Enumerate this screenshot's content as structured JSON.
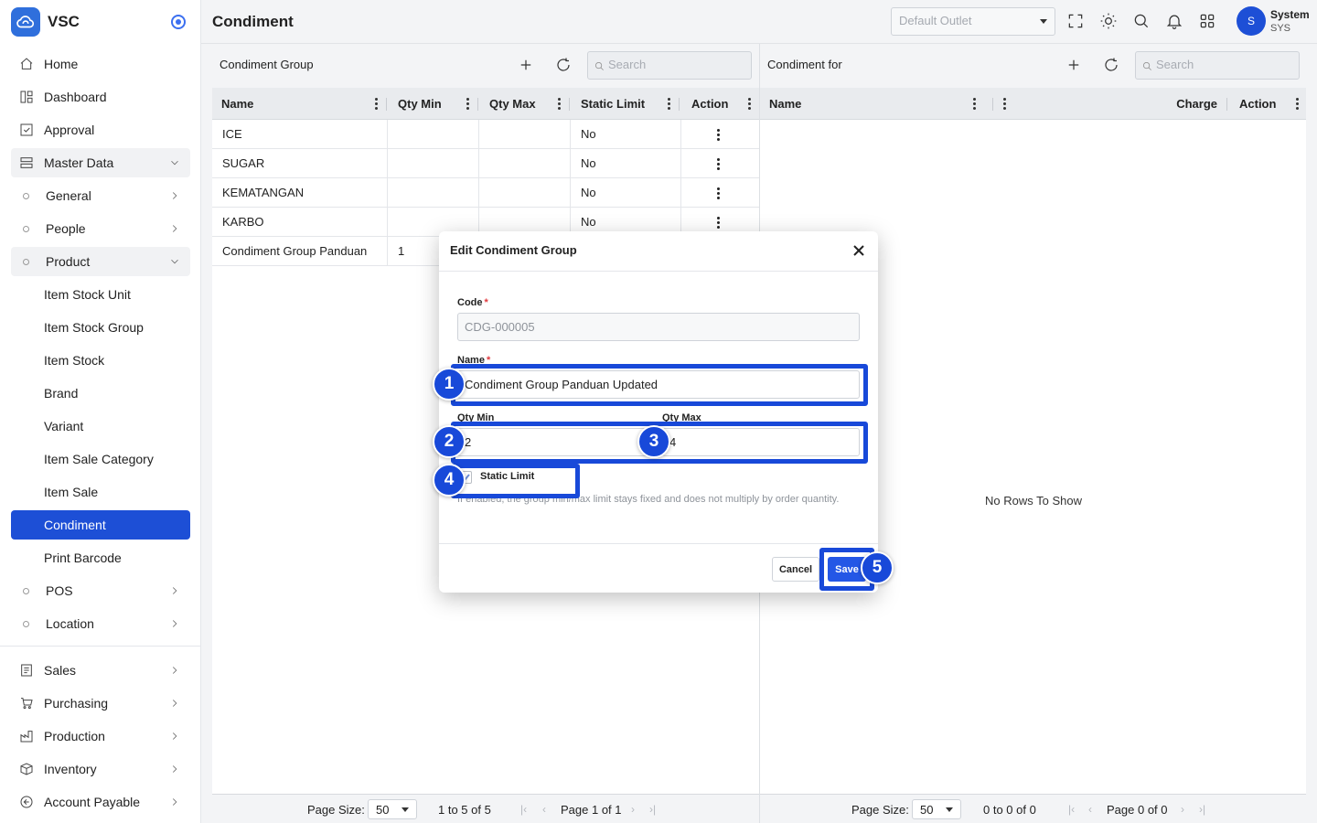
{
  "brand": {
    "name": "VSC"
  },
  "nav": {
    "home": "Home",
    "dashboard": "Dashboard",
    "approval": "Approval",
    "master_data": "Master Data",
    "general": "General",
    "people": "People",
    "product": "Product",
    "product_items": [
      "Item Stock Unit",
      "Item Stock Group",
      "Item Stock",
      "Brand",
      "Variant",
      "Item Sale Category",
      "Item Sale",
      "Condiment",
      "Print Barcode"
    ],
    "pos": "POS",
    "location": "Location",
    "sales": "Sales",
    "purchasing": "Purchasing",
    "production": "Production",
    "inventory": "Inventory",
    "account_payable": "Account Payable"
  },
  "header": {
    "title": "Condiment",
    "outlet_placeholder": "Default Outlet",
    "user_initial": "S",
    "user_name": "System",
    "user_code": "SYS"
  },
  "left_panel": {
    "title": "Condiment Group",
    "search_placeholder": "Search",
    "columns": [
      "Name",
      "Qty Min",
      "Qty Max",
      "Static Limit",
      "Action"
    ],
    "rows": [
      {
        "name": "ICE",
        "qty_min": "",
        "qty_max": "",
        "static_limit": "No"
      },
      {
        "name": "SUGAR",
        "qty_min": "",
        "qty_max": "",
        "static_limit": "No"
      },
      {
        "name": "KEMATANGAN",
        "qty_min": "",
        "qty_max": "",
        "static_limit": "No"
      },
      {
        "name": "KARBO",
        "qty_min": "",
        "qty_max": "",
        "static_limit": "No"
      },
      {
        "name": "Condiment Group Panduan",
        "qty_min": "1",
        "qty_max": "",
        "static_limit": ""
      }
    ],
    "page_size_label": "Page Size:",
    "page_size": "50",
    "summary": "1 to 5 of 5",
    "page_info": "Page 1 of 1"
  },
  "right_panel": {
    "title": "Condiment for",
    "search_placeholder": "Search",
    "columns": [
      "Name",
      "",
      "Charge",
      "Action"
    ],
    "empty_text": "No Rows To Show",
    "page_size_label": "Page Size:",
    "page_size": "50",
    "summary": "0 to 0 of 0",
    "page_info": "Page 0 of 0"
  },
  "modal": {
    "title": "Edit Condiment Group",
    "code_label": "Code",
    "code_value": "CDG-000005",
    "name_label": "Name",
    "name_value": "Condiment Group Panduan Updated",
    "qty_min_label": "Qty Min",
    "qty_min_value": "2",
    "qty_max_label": "Qty Max",
    "qty_max_value": "4",
    "static_limit_label": "Static Limit",
    "help_text": "If enabled, the group min/max limit stays fixed and does not multiply by order quantity.",
    "cancel_label": "Cancel",
    "save_label": "Save",
    "required_mark": "*"
  },
  "annotations": [
    "1",
    "2",
    "3",
    "4",
    "5"
  ],
  "colors": {
    "accent": "#1d4fd6",
    "annotation": "#1849d9",
    "save": "#2457e6"
  }
}
